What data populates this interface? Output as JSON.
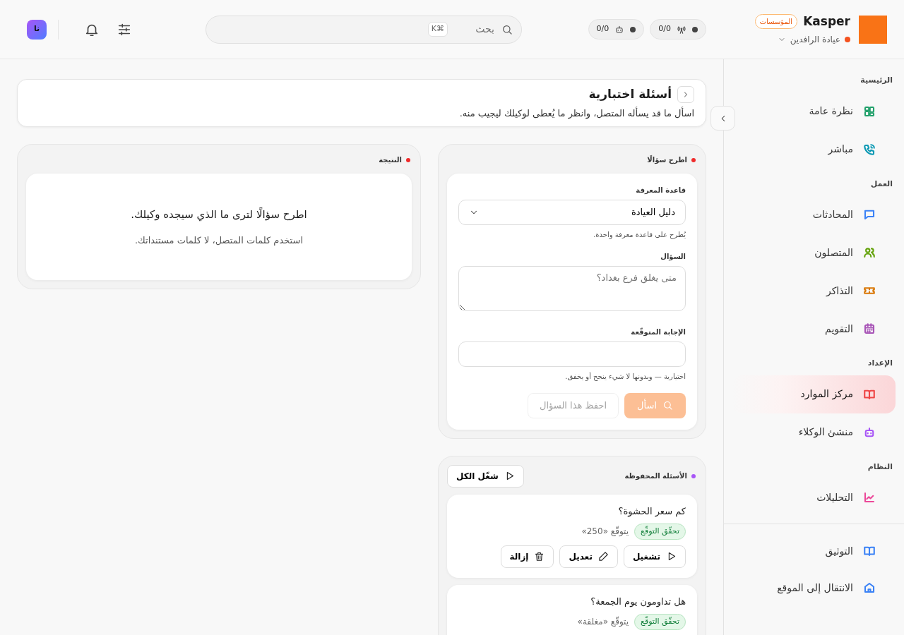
{
  "brand": {
    "name": "Kasper",
    "badge": "المؤسسات",
    "workspace": "عيادة الرافدين"
  },
  "status_pills": [
    {
      "reading": "0/0"
    },
    {
      "reading": "0/0"
    }
  ],
  "search": {
    "placeholder": "بحث",
    "shortcut": "⌘K"
  },
  "avatar": {
    "initials": "نا"
  },
  "sidebar": {
    "sections": [
      {
        "title": "الرئيسية",
        "items": [
          {
            "label": "نظرة عامة",
            "color": "#22a06b",
            "selected": false
          },
          {
            "label": "مباشر",
            "color": "#0e9ab5",
            "selected": false
          }
        ]
      },
      {
        "title": "العمل",
        "items": [
          {
            "label": "المحادثات",
            "color": "#3b82f6",
            "selected": false
          },
          {
            "label": "المتصلون",
            "color": "#65a30d",
            "selected": false
          },
          {
            "label": "التذاكر",
            "color": "#d97706",
            "selected": false
          },
          {
            "label": "التقويم",
            "color": "#a855b7",
            "selected": false
          }
        ]
      },
      {
        "title": "الإعداد",
        "items": [
          {
            "label": "مركز الموارد",
            "color": "#ef4444",
            "selected": true
          },
          {
            "label": "منشئ الوكلاء",
            "color": "#a855f7",
            "selected": false
          }
        ]
      },
      {
        "title": "النظام",
        "items": [
          {
            "label": "التحليلات",
            "color": "#ec4899",
            "selected": false
          }
        ]
      }
    ],
    "footer": [
      {
        "label": "التوثيق",
        "color": "#3b82f6",
        "selected": false
      },
      {
        "label": "الانتقال إلى الموقع",
        "color": "#3b82f6",
        "selected": false
      }
    ]
  },
  "page": {
    "title": "أسئلة اختبارية",
    "subtitle": "اسأل ما قد يسأله المتصل، وانظر ما يُعطى لوكيلك ليجيب منه."
  },
  "ask_panel": {
    "title": "اطرح سؤالًا",
    "color": "#ef2b2b",
    "knowledge_base": {
      "label": "قاعدة المعرفة",
      "value": "دليل العيادة",
      "help": "يُطرح على قاعدة معرفة واحدة."
    },
    "question": {
      "label": "السؤال",
      "placeholder": "متى يغلق فرع بغداد؟"
    },
    "expected": {
      "label": "الإجابة المتوقّعة",
      "help": "اختيارية — وبدونها لا شيء ينجح أو يخفق."
    },
    "buttons": [
      {
        "kind": "ask",
        "label": "اسأل",
        "disabled": true
      },
      {
        "kind": "save",
        "label": "احفظ هذا السؤال",
        "disabled": true
      }
    ]
  },
  "saved_panel": {
    "title": "الأسئلة المحفوظة",
    "color": "#a855f7",
    "run_all": "شغّل الكل",
    "questions": [
      {
        "text": "كم سعر الحشوة؟",
        "badge": "تحقّق التوقّع",
        "expectation": "يتوقّع «250»",
        "actions": [
          {
            "kind": "run",
            "label": "تشغيل"
          },
          {
            "kind": "edit",
            "label": "تعديل"
          },
          {
            "kind": "remove",
            "label": "إزالة"
          }
        ]
      },
      {
        "text": "هل تداومون يوم الجمعة؟",
        "badge": "تحقّق التوقّع",
        "expectation": "يتوقّع «مغلقة»"
      }
    ]
  },
  "result_panel": {
    "title": "النتيجة",
    "color": "#ef2b2b",
    "empty_title": "اطرح سؤالًا لترى ما الذي سيجده وكيلك.",
    "empty_text": "استخدم كلمات المتصل، لا كلمات مستنداتك."
  }
}
